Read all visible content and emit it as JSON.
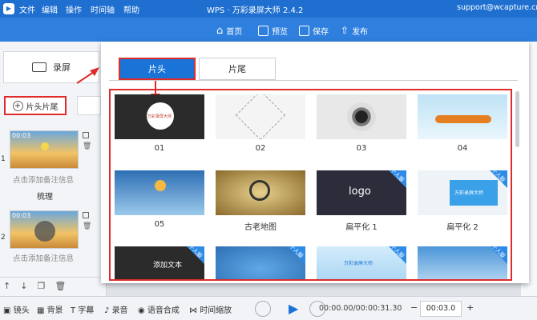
{
  "app": {
    "icon_label": "WPS",
    "title": "WPS · 万彩录屏大师 2.4.2",
    "email": "support@wcapture.cn"
  },
  "menu": [
    "文件",
    "编辑",
    "操作",
    "时间轴",
    "帮助"
  ],
  "toolbar": {
    "home": "首页",
    "preview": "预览",
    "save": "保存",
    "publish": "发布"
  },
  "left": {
    "record_label": "录屏",
    "intro_outro_label": "片头片尾",
    "clips": [
      {
        "index": "1",
        "time": "00:03",
        "note": "点击添加备注信息",
        "title": "梳理"
      },
      {
        "index": "2",
        "time": "00:03",
        "note": "点击添加备注信息"
      }
    ]
  },
  "dialog": {
    "tabs": [
      "片头",
      "片尾"
    ],
    "active_tab": "片头",
    "templates": [
      {
        "name": "01",
        "thumb_text": "万彩录屏大师",
        "badge": ""
      },
      {
        "name": "02",
        "thumb_text": "",
        "badge": ""
      },
      {
        "name": "03",
        "thumb_text": "",
        "badge": ""
      },
      {
        "name": "04",
        "thumb_text": "",
        "badge": ""
      },
      {
        "name": "05",
        "thumb_text": "",
        "badge": ""
      },
      {
        "name": "古老地图",
        "thumb_text": "",
        "badge": ""
      },
      {
        "name": "扁平化 1",
        "thumb_text": "logo",
        "badge": "个人版"
      },
      {
        "name": "扁平化 2",
        "thumb_text": "万彩录屏大师",
        "badge": "个人版"
      },
      {
        "name": "",
        "thumb_text": "添加文本",
        "badge": "个人版"
      },
      {
        "name": "",
        "thumb_text": "",
        "badge": "个人版"
      },
      {
        "name": "",
        "thumb_text": "万彩录屏大师",
        "badge": "个人版"
      },
      {
        "name": "",
        "thumb_text": "",
        "badge": "个人版"
      }
    ]
  },
  "bottom": {
    "tools": [
      "镜头",
      "背景",
      "字幕",
      "录音",
      "语音合成",
      "时间缩放"
    ],
    "time": "00:00.00/00:00:31.30",
    "duration": "00:03.0",
    "minus": "−",
    "plus": "+"
  },
  "colors": {
    "title": "#1e6fd0",
    "toolbar": "#2e7fde",
    "accent": "#1a73d6",
    "highlight": "#e02b2b"
  }
}
